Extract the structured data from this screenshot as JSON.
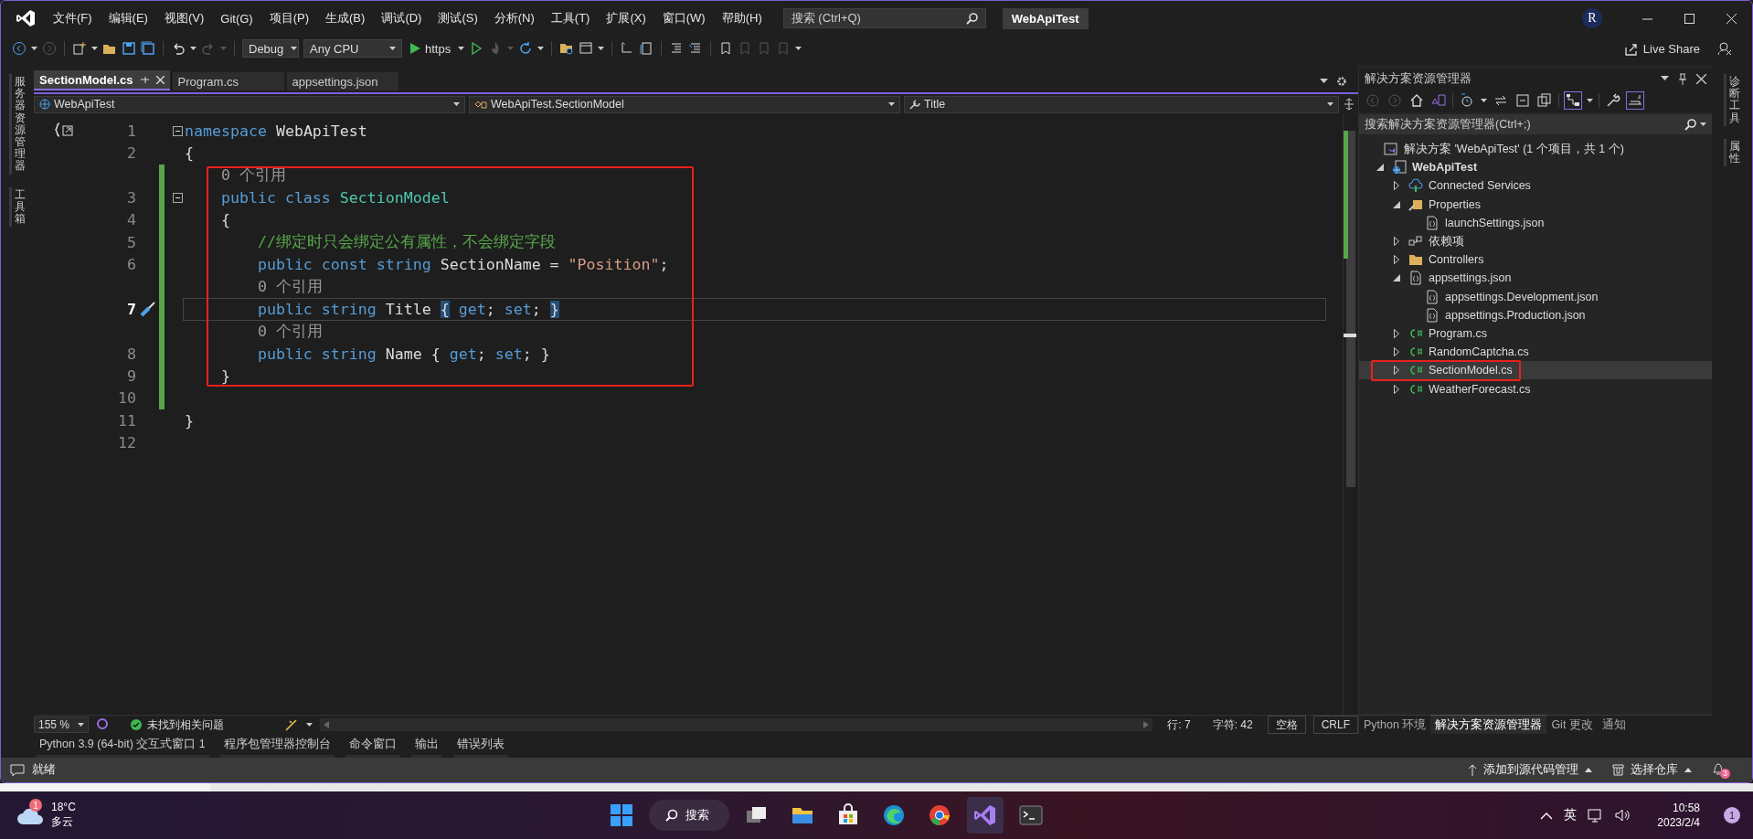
{
  "window": {
    "title": "WebApiTest",
    "search": {
      "placeholder": "搜索 (Ctrl+Q)"
    },
    "account": "R"
  },
  "menu": [
    "文件(F)",
    "编辑(E)",
    "视图(V)",
    "Git(G)",
    "项目(P)",
    "生成(B)",
    "调试(D)",
    "测试(S)",
    "分析(N)",
    "工具(T)",
    "扩展(X)",
    "窗口(W)",
    "帮助(H)"
  ],
  "toolbar": {
    "configuration": "Debug",
    "platform": "Any CPU",
    "run_target": "https",
    "live_share": "Live Share"
  },
  "left_tool_tabs": [
    "服务器资源管理器",
    "工具箱"
  ],
  "document_tabs": [
    {
      "label": "SectionModel.cs",
      "selected": true
    },
    {
      "label": "Program.cs",
      "selected": false
    },
    {
      "label": "appsettings.json",
      "selected": false
    }
  ],
  "navigation_bar": {
    "project": "WebApiTest",
    "type": "WebApiTest.SectionModel",
    "member": "Title"
  },
  "editor": {
    "rows": [
      {
        "kind": "code",
        "number": "1",
        "fold": true,
        "changed": false,
        "current": false,
        "quick_actions": false,
        "tokens": [
          {
            "kind": "kw",
            "s": "namespace"
          },
          {
            "kind": "plain",
            "s": " WebApiTest"
          }
        ]
      },
      {
        "kind": "code",
        "number": "2",
        "fold": false,
        "changed": false,
        "current": false,
        "quick_actions": false,
        "tokens": [
          {
            "kind": "plain",
            "s": "{"
          }
        ]
      },
      {
        "kind": "lens",
        "text": "0 个引用",
        "changed": true
      },
      {
        "kind": "code",
        "number": "3",
        "fold": true,
        "changed": true,
        "current": false,
        "quick_actions": false,
        "tokens": [
          {
            "kind": "kw",
            "s": "    public class "
          },
          {
            "kind": "type",
            "s": "SectionModel"
          }
        ]
      },
      {
        "kind": "code",
        "number": "4",
        "fold": false,
        "changed": true,
        "current": false,
        "quick_actions": false,
        "tokens": [
          {
            "kind": "plain",
            "s": "    {"
          }
        ]
      },
      {
        "kind": "code",
        "number": "5",
        "fold": false,
        "changed": true,
        "current": false,
        "quick_actions": false,
        "tokens": [
          {
            "kind": "comment",
            "s": "        //绑定时只会绑定公有属性，不会绑定字段"
          }
        ]
      },
      {
        "kind": "code",
        "number": "6",
        "fold": false,
        "changed": true,
        "current": false,
        "quick_actions": false,
        "tokens": [
          {
            "kind": "kw",
            "s": "        public const string "
          },
          {
            "kind": "plain",
            "s": "SectionName = "
          },
          {
            "kind": "string",
            "s": "\"Position\""
          },
          {
            "kind": "plain",
            "s": ";"
          }
        ]
      },
      {
        "kind": "lens",
        "text": "0 个引用",
        "changed": true
      },
      {
        "kind": "code",
        "number": "7",
        "fold": false,
        "changed": true,
        "current": true,
        "quick_actions": true,
        "tokens": [
          {
            "kind": "kw",
            "s": "        public string "
          },
          {
            "kind": "plain",
            "s": "Title "
          },
          {
            "kind": "brace",
            "s": "{"
          },
          {
            "kind": "kw",
            "s": " get"
          },
          {
            "kind": "plain",
            "s": "; "
          },
          {
            "kind": "kw",
            "s": "set"
          },
          {
            "kind": "plain",
            "s": "; "
          },
          {
            "kind": "brace",
            "s": "}"
          }
        ]
      },
      {
        "kind": "lens",
        "text": "0 个引用",
        "changed": true
      },
      {
        "kind": "code",
        "number": "8",
        "fold": false,
        "changed": true,
        "current": false,
        "quick_actions": false,
        "tokens": [
          {
            "kind": "kw",
            "s": "        public string "
          },
          {
            "kind": "plain",
            "s": "Name { "
          },
          {
            "kind": "kw",
            "s": "get"
          },
          {
            "kind": "plain",
            "s": "; "
          },
          {
            "kind": "kw",
            "s": "set"
          },
          {
            "kind": "plain",
            "s": "; }"
          }
        ]
      },
      {
        "kind": "code",
        "number": "9",
        "fold": false,
        "changed": true,
        "current": false,
        "quick_actions": false,
        "tokens": [
          {
            "kind": "plain",
            "s": "    }"
          }
        ]
      },
      {
        "kind": "code",
        "number": "10",
        "fold": false,
        "changed": true,
        "current": false,
        "quick_actions": false
      },
      {
        "kind": "code",
        "number": "11",
        "fold": false,
        "changed": false,
        "current": false,
        "quick_actions": false,
        "tokens": [
          {
            "kind": "plain",
            "s": "}"
          }
        ]
      },
      {
        "kind": "code",
        "number": "12",
        "fold": false,
        "changed": false,
        "current": false,
        "quick_actions": false
      }
    ]
  },
  "editor_status": {
    "zoom": "155 %",
    "issues": "未找到相关问题",
    "line": "行: 7",
    "column": "字符: 42",
    "whitespace": "空格",
    "line_ending": "CRLF"
  },
  "tool_window_tabs": [
    "Python 3.9 (64-bit) 交互式窗口 1",
    "程序包管理器控制台",
    "命令窗口",
    "输出",
    "错误列表"
  ],
  "solution_explorer": {
    "title": "解决方案资源管理器",
    "search": {
      "placeholder": "搜索解决方案资源管理器(Ctrl+;)"
    },
    "tree": [
      {
        "label": "解决方案 'WebApiTest' (1 个项目，共 1 个)",
        "kind": "solution",
        "selected": false,
        "children": [
          {
            "label": "WebApiTest",
            "kind": "project",
            "expanded": true,
            "selected": false,
            "children": [
              {
                "label": "Connected Services",
                "kind": "service",
                "expanded": false,
                "selected": false
              },
              {
                "label": "Properties",
                "kind": "properties",
                "expanded": true,
                "selected": false,
                "children": [
                  {
                    "label": "launchSettings.json",
                    "kind": "json",
                    "selected": false
                  }
                ]
              },
              {
                "label": "依赖项",
                "kind": "dependencies",
                "expanded": false,
                "selected": false
              },
              {
                "label": "Controllers",
                "kind": "folder",
                "expanded": false,
                "selected": false
              },
              {
                "label": "appsettings.json",
                "kind": "json",
                "expanded": true,
                "selected": false,
                "children": [
                  {
                    "label": "appsettings.Development.json",
                    "kind": "json",
                    "selected": false
                  },
                  {
                    "label": "appsettings.Production.json",
                    "kind": "json",
                    "selected": false
                  }
                ]
              },
              {
                "label": "Program.cs",
                "kind": "csharp",
                "expanded": false,
                "selected": false
              },
              {
                "label": "RandomCaptcha.cs",
                "kind": "csharp",
                "expanded": false,
                "selected": false
              },
              {
                "label": "SectionModel.cs",
                "kind": "csharp",
                "expanded": false,
                "selected": true,
                "annotated": true
              },
              {
                "label": "WeatherForecast.cs",
                "kind": "csharp",
                "expanded": false,
                "selected": false
              }
            ]
          }
        ]
      }
    ]
  },
  "explorer_tabs": [
    {
      "label": "Python 环境",
      "selected": false
    },
    {
      "label": "解决方案资源管理器",
      "selected": true
    },
    {
      "label": "Git 更改",
      "selected": false
    },
    {
      "label": "通知",
      "selected": false
    }
  ],
  "right_tool_tabs": [
    "诊断工具",
    "属性"
  ],
  "status_bar": {
    "message": "就绪",
    "source_control": "添加到源代码管理",
    "repository": "选择仓库",
    "notifications": "3"
  },
  "taskbar": {
    "weather": {
      "badge": "1",
      "temperature": "18°C",
      "condition": "多云"
    },
    "search": "搜索",
    "input_method": "英",
    "time": "10:58",
    "date": "2023/2/4",
    "notification_count": "1"
  }
}
